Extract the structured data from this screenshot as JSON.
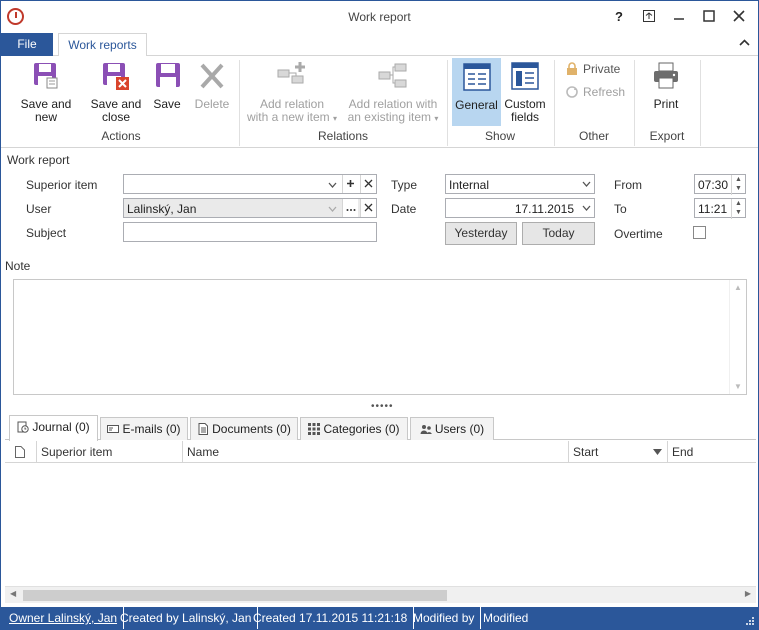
{
  "window": {
    "title": "Work report"
  },
  "titlebar_buttons": [
    "?",
    "↖",
    "–",
    "□",
    "✕"
  ],
  "ribbon_tabs": {
    "file": "File",
    "active": "Work reports"
  },
  "ribbon": {
    "save_and_new": "Save and new",
    "save_and_close_1": "Save and",
    "save_and_close_2": "close",
    "save": "Save",
    "delete": "Delete",
    "actions_group": "Actions",
    "add_relation_new_1": "Add relation",
    "add_relation_new_2": "with a new item",
    "add_relation_existing_1": "Add relation with",
    "add_relation_existing_2": "an existing item",
    "relations_group": "Relations",
    "general": "General",
    "custom_fields_1": "Custom",
    "custom_fields_2": "fields",
    "show_group": "Show",
    "private": "Private",
    "refresh": "Refresh",
    "other_group": "Other",
    "print": "Print",
    "export_group": "Export"
  },
  "form": {
    "section_title": "Work report",
    "superior_item_label": "Superior item",
    "superior_item_value": "",
    "user_label": "User",
    "user_value": "Lalinský, Jan",
    "subject_label": "Subject",
    "subject_value": "",
    "type_label": "Type",
    "type_value": "Internal",
    "date_label": "Date",
    "date_value": "17.11.2015",
    "yesterday_button": "Yesterday",
    "today_button": "Today",
    "from_label": "From",
    "from_value": "07:30",
    "to_label": "To",
    "to_value": "11:21",
    "overtime_label": "Overtime",
    "note_label": "Note"
  },
  "bottom_tabs": {
    "journal": "Journal (0)",
    "emails": "E-mails (0)",
    "documents": "Documents (0)",
    "categories": "Categories (0)",
    "users": "Users (0)"
  },
  "grid_columns": {
    "superior_item": "Superior item",
    "name": "Name",
    "start": "Start",
    "end": "End"
  },
  "statusbar": {
    "owner": "Owner Lalinský, Jan",
    "created_by": "Created by Lalinský, Jan",
    "created": "Created 17.11.2015 11:21:18",
    "modified_by": "Modified by",
    "modified": "Modified"
  },
  "colors": {
    "accent": "#2b579a",
    "delete_red": "#d9442c",
    "save_purple": "#8b4fb5",
    "selected": "#b8d6f0"
  }
}
